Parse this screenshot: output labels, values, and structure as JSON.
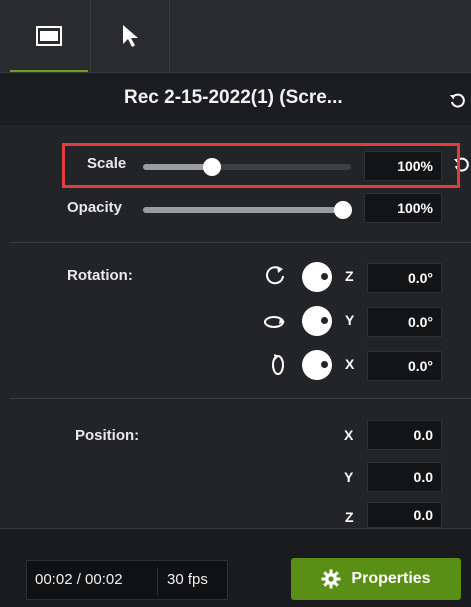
{
  "clip": {
    "title": "Rec 2-15-2022(1) (Scre..."
  },
  "visual": {
    "scale": {
      "label": "Scale",
      "value": "100%",
      "level": 0.33
    },
    "opacity": {
      "label": "Opacity",
      "value": "100%",
      "level": 1.0
    }
  },
  "rotation": {
    "label": "Rotation:",
    "axes": [
      {
        "axis": "Z",
        "value": "0.0°"
      },
      {
        "axis": "Y",
        "value": "0.0°"
      },
      {
        "axis": "X",
        "value": "0.0°"
      }
    ]
  },
  "position": {
    "label": "Position:",
    "axes": [
      {
        "axis": "X",
        "value": "0.0"
      },
      {
        "axis": "Y",
        "value": "0.0"
      },
      {
        "axis": "Z",
        "value": "0.0"
      }
    ]
  },
  "footer": {
    "time": "00:02 / 00:02",
    "fps": "30 fps",
    "properties_label": "Properties"
  },
  "colors": {
    "accent_green": "#6e9f23",
    "button_green": "#5a8f16",
    "highlight_red": "#e23c43"
  }
}
